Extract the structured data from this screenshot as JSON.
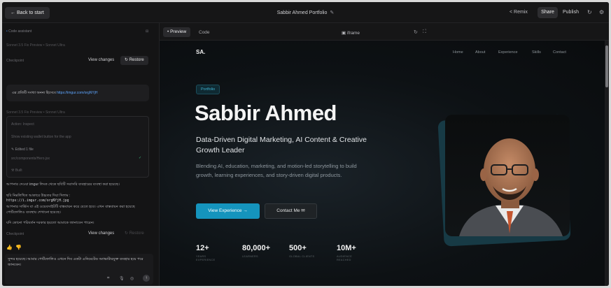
{
  "topbar": {
    "back_label": "← Back to start",
    "project_title": "Sabbir Ahmed Portfolio",
    "edit_icon": "pencil-icon",
    "remix_label": "Remix",
    "share_label": "Share",
    "publish_label": "Publish"
  },
  "chat": {
    "header_label": "Code assistant",
    "meta_1": "Sonnet 3.5 Fix Preview • Sonnet Ultra",
    "checkpoint_label": "Checkpoint",
    "view_changes_label": "View changes",
    "restore_label": "↻ Restore",
    "user_message_prefix": "এর প্রতিটি সংখ্যা অনন্য হিসেবে",
    "user_message_link": "https://imgur.com/orgNYjH",
    "meta_2": "Sonnet 3.5 Fix Preview • Sonnet Ultra",
    "card_item_1": "Action: Inspect",
    "card_item_2": "Show existing wallet button for the app",
    "card_item_3": "Edited 1 file",
    "card_item_4": "src/components/Hero.jsx",
    "card_item_5": "Built",
    "msg_1": "আপনার দেওয়া imgur লিংক থেকে ছবিটি সরাসরি ব্যবহারের ব্যবস্থা করা হয়েছে।",
    "msg_2a": "ছবি নিম্নলিখিত আকারে উচ্চতর দিয়া দিলাম :",
    "msg_2b": "https://i.imgur.com/orgNYjH.jpg",
    "msg_2c": "আপনার সার্ভিস বা এই ওয়েবসাইটটি বাস্তবায়ন করে যেতে হবে। এখন বাস্তবায়ন করা হয়েছে পোর্টফোলিও ব্যবস্থায় শেখানো হয়েছে।",
    "msg_3": "যদি কোনো পরিবর্তন দরকার হয়তো আমাকে জানাবেন পারেন।",
    "checkpoint_label_2": "Checkpoint",
    "view_changes_label_2": "View changes",
    "restore_label_2": "↻ Restore",
    "reply_text": "সুন্দর হয়েছে। আমার পোর্টফোলিও এখনে দিব একটা এনিমেটেড অ্যাভাটারযুক্ত ব্যবহার হয়ে পরে জানবেন।"
  },
  "preview_toolbar": {
    "tab_preview": "• Preview",
    "tab_code": "Code",
    "iframe_label": "iframe"
  },
  "site": {
    "logo": "SA.",
    "nav": [
      "Home",
      "About",
      "Experience",
      "Skills",
      "Contact"
    ],
    "badge": "Portfolio",
    "title": "Sabbir Ahmed",
    "subtitle": "Data-Driven Digital Marketing, AI Content & Creative Growth Leader",
    "description": "Blending AI, education, marketing, and motion-led storytelling to build growth, learning experiences, and story-driven digital products.",
    "primary_button": "View Experience →",
    "secondary_button": "Contact Me ✉",
    "stats": [
      {
        "value": "12+",
        "label": "YEARS EXPERIENCE"
      },
      {
        "value": "80,000+",
        "label": "LEARNERS"
      },
      {
        "value": "500+",
        "label": "GLOBAL CLIENTS"
      },
      {
        "value": "10M+",
        "label": "AUDIENCE REACHED"
      }
    ]
  },
  "colors": {
    "accent": "#1594bd",
    "badge_text": "#3fb2cf",
    "background": "#0f0f10"
  }
}
